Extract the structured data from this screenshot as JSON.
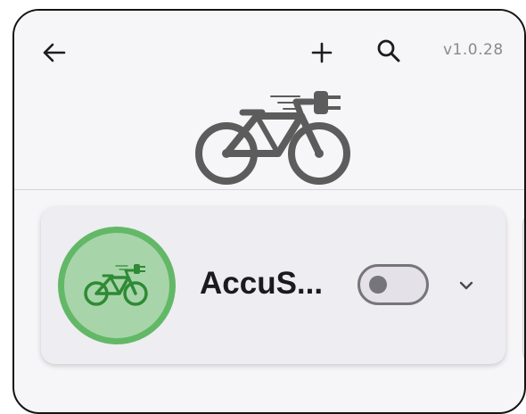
{
  "toolbar": {
    "back_icon": "arrow-left-icon",
    "add_icon": "plus-icon",
    "search_icon": "search-icon",
    "version": "v1.0.28"
  },
  "logo": {
    "icon": "electric-bike-plug-icon"
  },
  "device_card": {
    "title": "AccuS...",
    "icon": "electric-bike-icon",
    "toggle_on": false,
    "expand_icon": "chevron-down-icon"
  },
  "colors": {
    "background": "#f6f5f7",
    "card": "#eeedf1",
    "accent_green": "#63b867",
    "avatar_fill": "#a7d5a9",
    "icon_green": "#2e8a34",
    "logo_gray": "#5c5c5c"
  }
}
